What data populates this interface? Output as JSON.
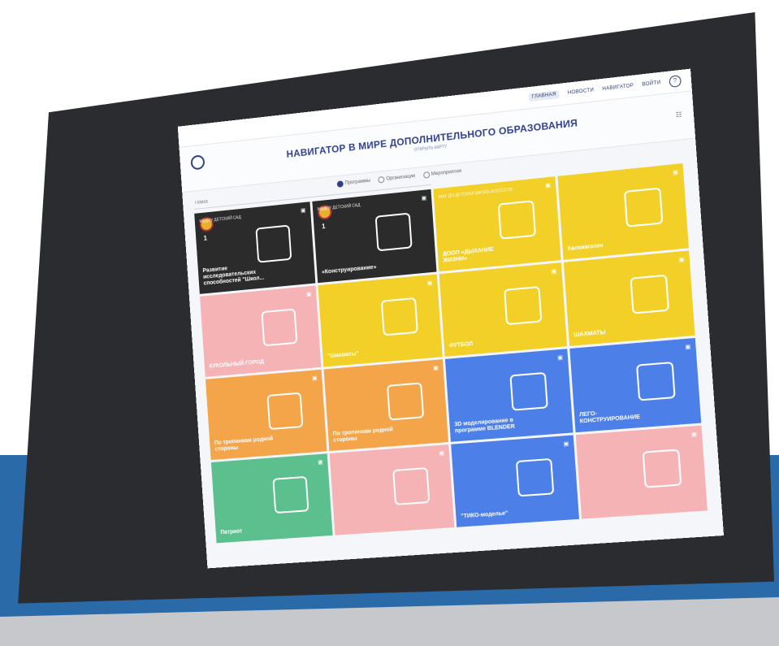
{
  "colors": {
    "black": "#2b2b2b",
    "yellow": "#f2d027",
    "pink": "#f6b3b6",
    "orange": "#f4a54a",
    "blue": "#4c7fe8",
    "green": "#5bbf8e",
    "background": "#2a6aa8"
  },
  "nav": {
    "items": [
      "ГЛАВНАЯ",
      "НОВОСТИ",
      "НАВИГАТОР",
      "ВОЙТИ"
    ],
    "help": "?"
  },
  "header": {
    "title": "НАВИГАТОР В МИРЕ ДОПОЛНИТЕЛЬНОГО ОБРАЗОВАНИЯ",
    "map_link": "ОТКРЫТЬ КАРТУ"
  },
  "search": {
    "placeholder": "Поиск"
  },
  "filter": {
    "options": [
      "Программы",
      "Организации",
      "Мероприятия"
    ],
    "selected": "Программы"
  },
  "cards": [
    {
      "color": "black",
      "org": "МБДОУ ДЕТСКИЙ САД",
      "title": "Развитие исследовательских способностей \"Школ...",
      "medal": "1",
      "icon": "microscope-icon"
    },
    {
      "color": "black",
      "org": "МБДОУ ДЕТСКИЙ САД",
      "title": "«Конструирование»",
      "medal": "1",
      "icon": "house-icon"
    },
    {
      "color": "yellow",
      "org": "МАУ ДО ДЕТСКАЯ ШКОЛА ИСКУССТВ",
      "title": "ДООП «ДЫХАНИЕ ЖИЗНИ»",
      "icon": "gymnast-icon"
    },
    {
      "color": "yellow",
      "org": "",
      "title": "Калокагатия",
      "icon": "athlete-icon"
    },
    {
      "color": "pink",
      "org": "",
      "title": "КУКОЛЬНЫЙ ГОРОД",
      "icon": "masks-icon"
    },
    {
      "color": "yellow",
      "org": "",
      "title": "\"Шахматы\"",
      "icon": "chess-icon"
    },
    {
      "color": "yellow",
      "org": "",
      "title": "ФУТБОЛ",
      "icon": "athlete-icon"
    },
    {
      "color": "yellow",
      "org": "",
      "title": "ШАХМАТЫ",
      "icon": "chess-icon"
    },
    {
      "color": "orange",
      "org": "",
      "title": "По тропинкам родной стороны",
      "icon": "globe-pin-icon"
    },
    {
      "color": "orange",
      "org": "",
      "title": "По тропинкам родной стороны",
      "icon": "globe-pin-icon"
    },
    {
      "color": "blue",
      "org": "",
      "title": "3D моделирование в программе BLENDER",
      "icon": "cube-icon"
    },
    {
      "color": "blue",
      "org": "",
      "title": "ЛЕГО-КОНСТРУИРОВАНИЕ",
      "icon": "robot-icon"
    },
    {
      "color": "green",
      "org": "",
      "title": "Патриот",
      "icon": "flag-book-icon"
    },
    {
      "color": "pink",
      "org": "",
      "title": "",
      "icon": "flag-icon"
    },
    {
      "color": "blue",
      "org": "",
      "title": "\"ТИКО-моделье\"",
      "icon": "house-icon"
    },
    {
      "color": "pink",
      "org": "",
      "title": "",
      "icon": "easel-icon"
    }
  ]
}
